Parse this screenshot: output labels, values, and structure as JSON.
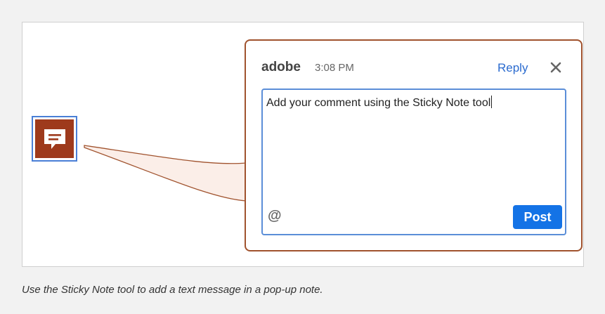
{
  "popup": {
    "author": "adobe",
    "time": "3:08 PM",
    "reply_label": "Reply",
    "close_icon": "close-icon",
    "comment_text": "Add your comment using the Sticky Note tool",
    "mention_symbol": "@",
    "post_label": "Post"
  },
  "note_icon": {
    "icon": "comment-icon",
    "color": "#9e3a1c"
  },
  "caption": "Use the Sticky Note tool to add a text message in a pop-up note.",
  "colors": {
    "accent": "#1473e6",
    "popup_border": "#a0522d",
    "link": "#2b6bcf",
    "focus_border": "#5b8ed8"
  }
}
